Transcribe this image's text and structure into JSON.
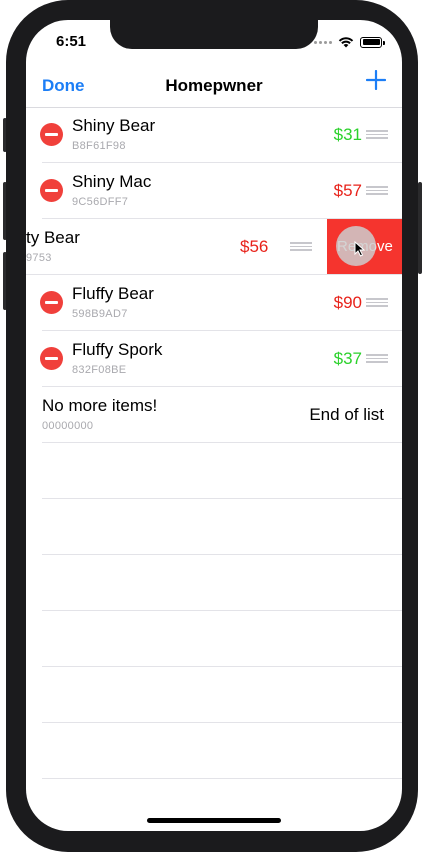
{
  "status": {
    "time": "6:51"
  },
  "nav": {
    "done_label": "Done",
    "title": "Homepwner",
    "add_icon": "plus-icon"
  },
  "items": [
    {
      "name": "Shiny Bear",
      "serial": "B8F61F98",
      "price": "$31",
      "price_color": "#2bd12b"
    },
    {
      "name": "Shiny Mac",
      "serial": "9C56DFF7",
      "price": "$57",
      "price_color": "#e8221a"
    },
    {
      "name": "ty Bear",
      "serial": "9753",
      "price": "$56",
      "price_color": "#e8221a",
      "swiped": true,
      "action_label": "Remove"
    },
    {
      "name": "Fluffy Bear",
      "serial": "598B9AD7",
      "price": "$90",
      "price_color": "#e8221a"
    },
    {
      "name": "Fluffy Spork",
      "serial": "832F08BE",
      "price": "$37",
      "price_color": "#2bd12b"
    }
  ],
  "footer_row": {
    "name": "No more items!",
    "serial": "00000000",
    "right_label": "End of list"
  },
  "colors": {
    "accent": "#1c7ef6",
    "delete": "#f0403b",
    "remove": "#f5342e"
  }
}
